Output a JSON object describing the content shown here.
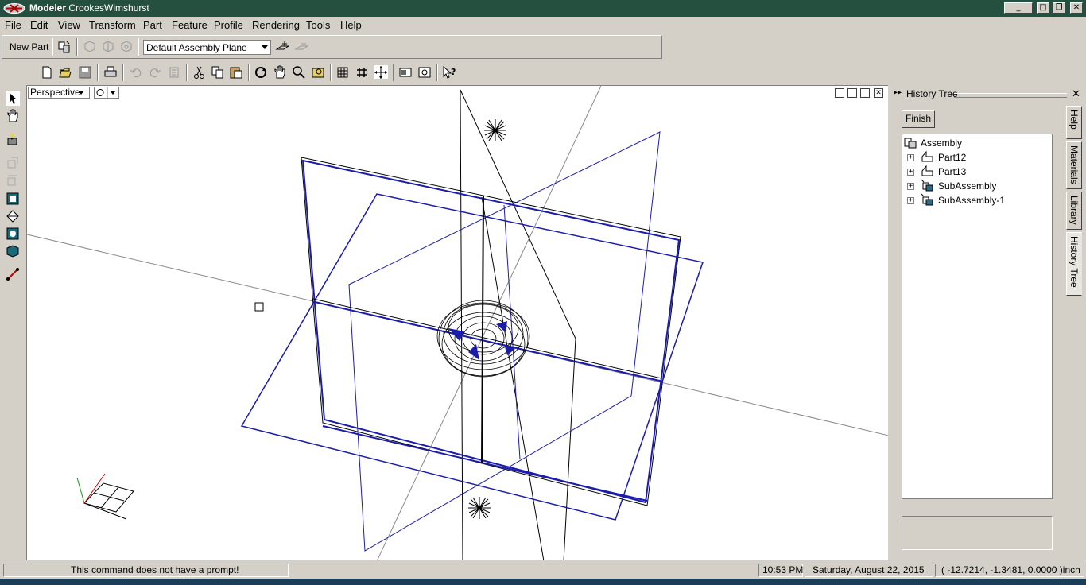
{
  "window": {
    "app_name": "Modeler",
    "document_name": "CrookesWimshurst",
    "controls": {
      "minimize": "_",
      "restore": "□",
      "maximize": "❐",
      "close": "✕"
    }
  },
  "menubar": {
    "items": [
      {
        "label": "File"
      },
      {
        "label": "Edit"
      },
      {
        "label": "View"
      },
      {
        "label": "Transform"
      },
      {
        "label": "Part"
      },
      {
        "label": "Feature"
      },
      {
        "label": "Profile"
      },
      {
        "label": "Rendering"
      },
      {
        "label": "Tools"
      },
      {
        "label": "Help"
      }
    ]
  },
  "toolbar": {
    "new_part_label": "New Part",
    "plane_select_value": "Default Assembly Plane"
  },
  "viewport": {
    "view_mode": "Perspective",
    "close_label": "✕"
  },
  "history_panel": {
    "title": "History Tree",
    "finish_label": "Finish",
    "tree": {
      "root": "Assembly",
      "children": [
        "Part12",
        "Part13",
        "SubAssembly",
        "SubAssembly-1"
      ]
    },
    "tabs": [
      "Help",
      "Materials",
      "Library",
      "History Tree"
    ],
    "close_label": "✕",
    "collapse_label": "▸▸"
  },
  "statusbar": {
    "prompt": "This command does not have a prompt!",
    "time": "10:53 PM",
    "date": "Saturday, August 22, 2015",
    "coords": "( -12.7214, -1.3481, 0.0000 )inch"
  },
  "colors": {
    "titlebar": "#254f3f",
    "wire_blue": "#1c1caa",
    "wire_black": "#000000",
    "face": "#d4d0c8"
  }
}
